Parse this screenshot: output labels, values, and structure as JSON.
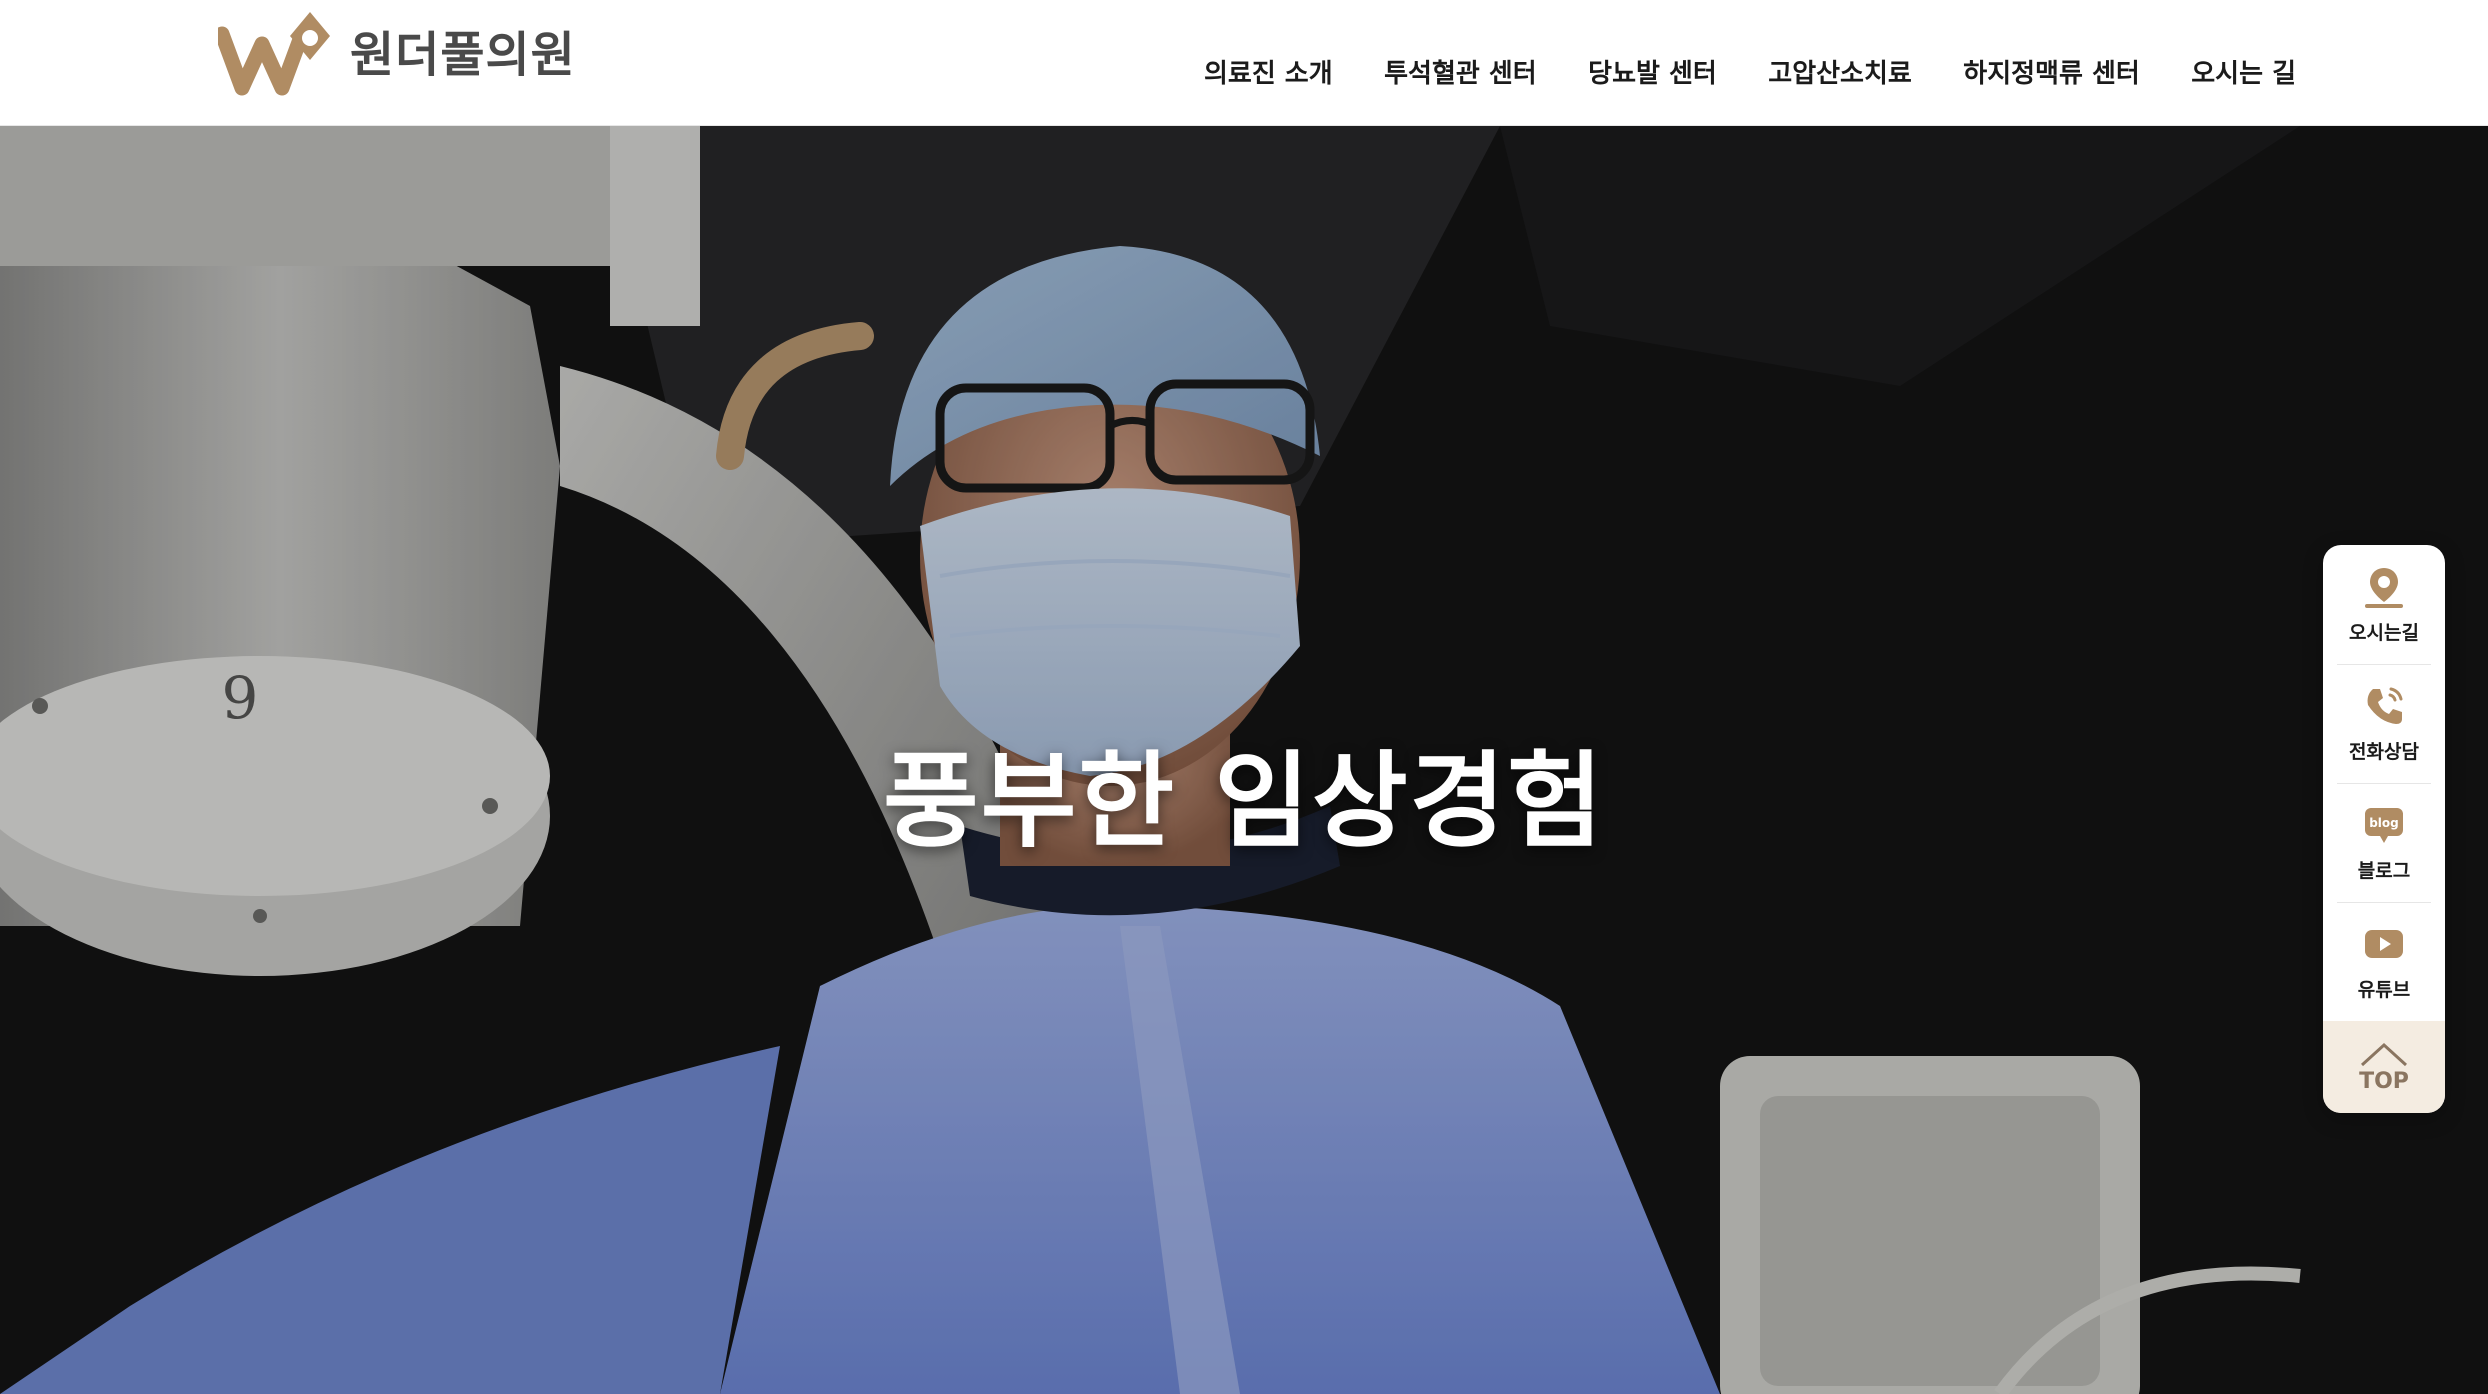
{
  "brand": {
    "name": "원더풀의원",
    "color": "#b08c63",
    "text_color": "#4a4a4a"
  },
  "nav": {
    "items": [
      {
        "label": "의료진 소개"
      },
      {
        "label": "투석혈관 센터"
      },
      {
        "label": "당뇨발 센터"
      },
      {
        "label": "고압산소치료"
      },
      {
        "label": "하지정맥류 센터"
      },
      {
        "label": "오시는 길"
      }
    ]
  },
  "hero": {
    "headline": "풍부한 임상경험",
    "scene_text": "9"
  },
  "quick_menu": {
    "accent": "#b08c63",
    "items": [
      {
        "label": "오시는길",
        "icon": "location-pin-icon"
      },
      {
        "label": "전화상담",
        "icon": "phone-icon"
      },
      {
        "label": "블로그",
        "icon": "blog-icon",
        "icon_text": "blog"
      },
      {
        "label": "유튜브",
        "icon": "youtube-icon"
      }
    ],
    "top_label": "TOP",
    "top_icon": "chevron-up-icon"
  }
}
